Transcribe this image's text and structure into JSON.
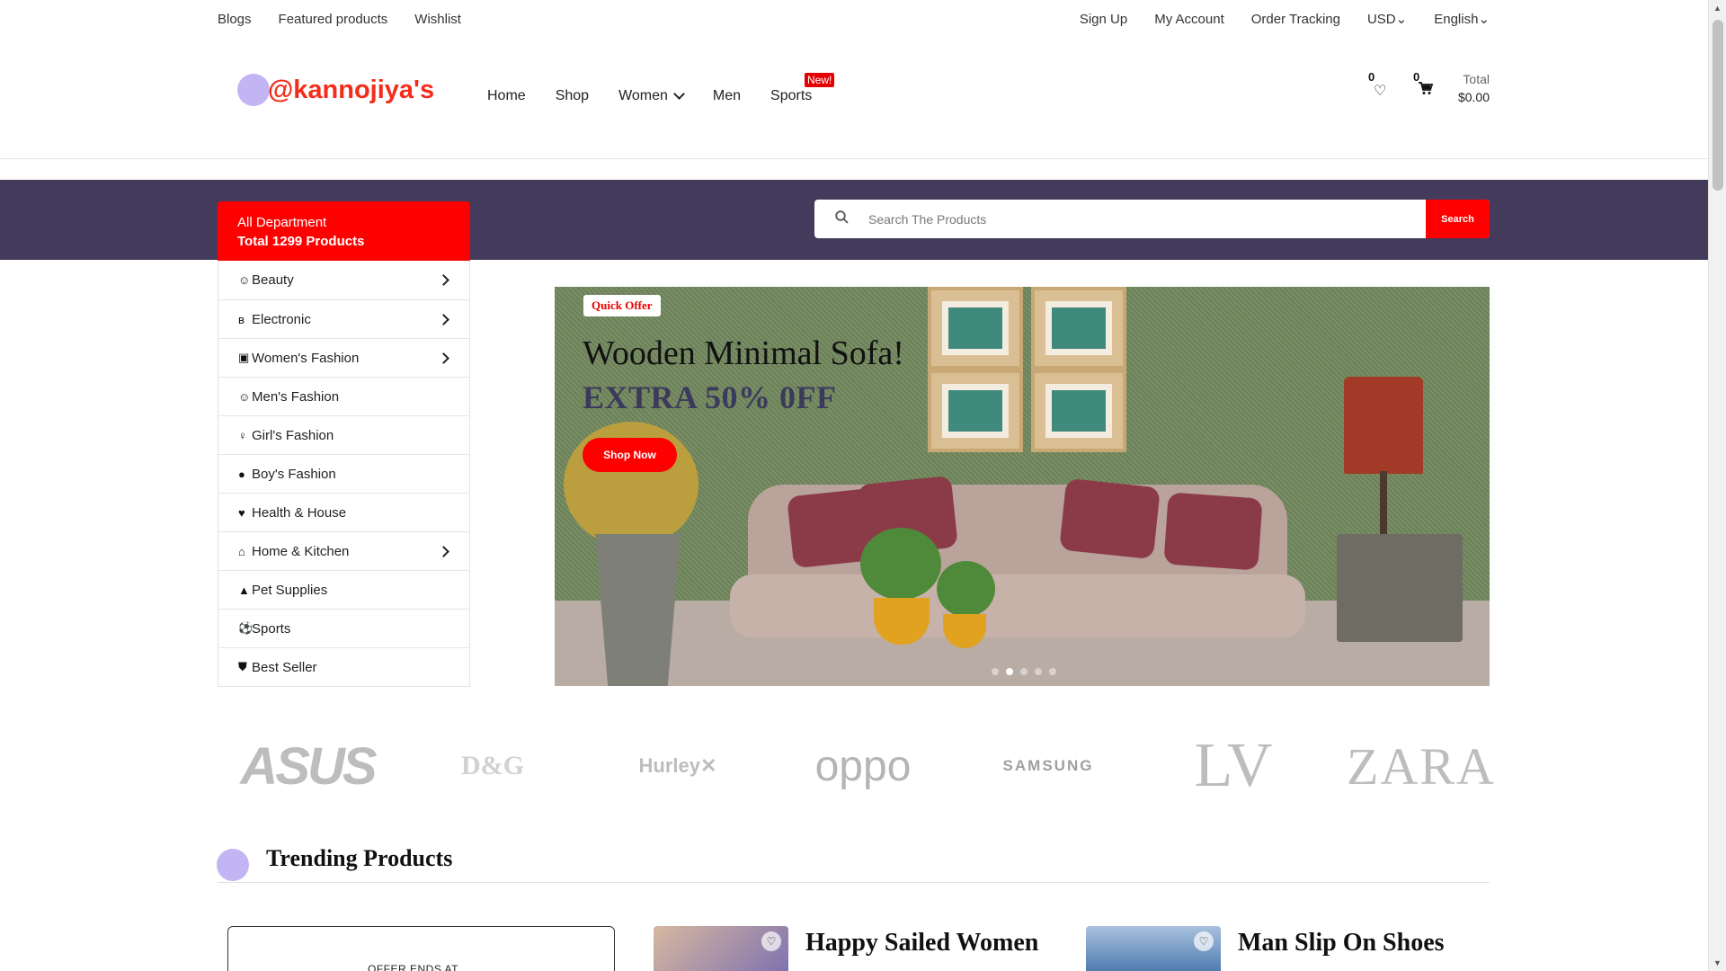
{
  "topbar": {
    "left_links": [
      "Blogs",
      "Featured products",
      "Wishlist"
    ],
    "right_links": [
      "Sign Up",
      "My Account",
      "Order Tracking"
    ],
    "currency": "USD",
    "language": "English"
  },
  "header": {
    "logo_text": "@kannojiya's",
    "nav": [
      "Home",
      "Shop",
      "Women",
      "Men",
      "Sports"
    ],
    "new_badge": "New!",
    "wishlist_count": "0",
    "cart_count": "0",
    "total_label": "Total",
    "total_amount": "$0.00"
  },
  "department": {
    "title": "All Department",
    "subtitle": "Total 1299 Products",
    "categories": [
      {
        "label": "Beauty",
        "icon": "smile-icon",
        "glyph": "☺",
        "has_sub": true
      },
      {
        "label": "Electronic",
        "icon": "bluetooth-icon",
        "glyph": "ʙ",
        "has_sub": true
      },
      {
        "label": "Women's Fashion",
        "icon": "shirt-icon",
        "glyph": "▣",
        "has_sub": true
      },
      {
        "label": "Men's Fashion",
        "icon": "smile-icon",
        "glyph": "☺",
        "has_sub": false
      },
      {
        "label": "Girl's Fashion",
        "icon": "female-icon",
        "glyph": "♀",
        "has_sub": false
      },
      {
        "label": "Boy's Fashion",
        "icon": "user-icon",
        "glyph": "●",
        "has_sub": false
      },
      {
        "label": "Health & House",
        "icon": "heart-pulse-icon",
        "glyph": "♥",
        "has_sub": false
      },
      {
        "label": "Home & Kitchen",
        "icon": "home-icon",
        "glyph": "⌂",
        "has_sub": true
      },
      {
        "label": "Pet Supplies",
        "icon": "pet-icon",
        "glyph": "▲",
        "has_sub": false
      },
      {
        "label": "Sports",
        "icon": "football-icon",
        "glyph": "⚽",
        "has_sub": false
      },
      {
        "label": "Best Seller",
        "icon": "shield-icon",
        "glyph": "⛊",
        "has_sub": false
      }
    ]
  },
  "search": {
    "placeholder": "Search The Products",
    "button": "Search"
  },
  "hero": {
    "tag": "Quick Offer",
    "title": "Wooden Minimal Sofa!",
    "offer": "EXTRA 50% 0FF",
    "cta": "Shop Now",
    "slides": 5,
    "active_slide": 2
  },
  "brands": [
    "ASUS",
    "D&G",
    "Hurley",
    "oppo",
    "SAMSUNG",
    "LV",
    "ZARA"
  ],
  "trending": {
    "title": "Trending Products",
    "offer_text": "OFFER ENDS AT",
    "products": [
      "Happy Sailed Women",
      "Man Slip On Shoes"
    ]
  },
  "colors": {
    "accent": "#ff0000",
    "band": "#443a5b",
    "logo_dot": "#c3b4f3"
  }
}
